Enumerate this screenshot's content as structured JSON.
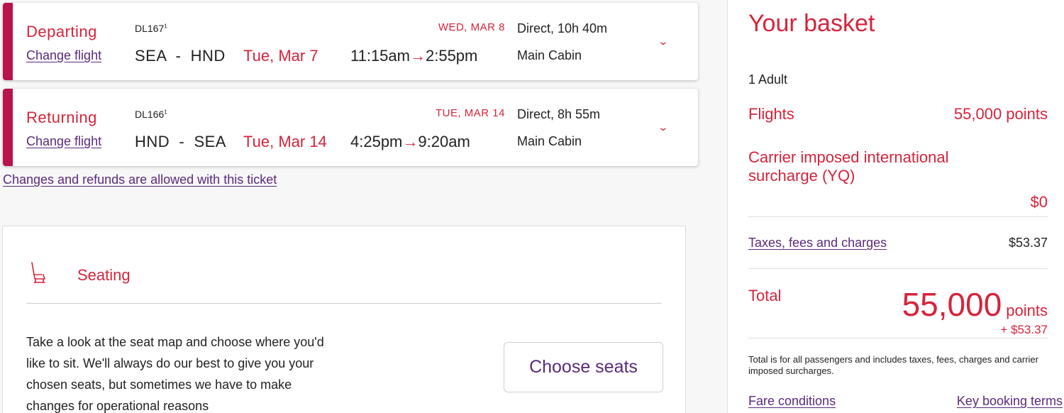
{
  "flights": [
    {
      "direction": "Departing",
      "change_label": "Change flight",
      "flight_number": "DL167",
      "flight_sup": "1",
      "route": "SEA  -  HND",
      "dep_date": "Tue, Mar 7",
      "arr_date": "WED, MAR 8",
      "dep_time": "11:15am",
      "arrow": "→",
      "arr_time": "2:55pm",
      "duration": "Direct, 10h 40m",
      "cabin": "Main Cabin",
      "chevron": "⌄"
    },
    {
      "direction": "Returning",
      "change_label": "Change flight",
      "flight_number": "DL166",
      "flight_sup": "1",
      "route": "HND  -  SEA",
      "dep_date": "Tue, Mar 14",
      "arr_date": "TUE, MAR 14",
      "dep_time": "4:25pm",
      "arrow": "→",
      "arr_time": "9:20am",
      "duration": "Direct, 8h 55m",
      "cabin": "Main Cabin",
      "chevron": "⌄"
    }
  ],
  "refund_link": "Changes and refunds are allowed with this ticket",
  "seating": {
    "title": "Seating",
    "icon": "seat-icon",
    "description": "Take a look at the seat map and choose where you'd like to sit. We'll always do our best to give you your chosen seats, but sometimes we have to make changes for operational reasons",
    "button_label": "Choose seats"
  },
  "basket": {
    "title": "Your basket",
    "passengers": "1 Adult",
    "flights_label": "Flights",
    "flights_value": "55,000 points",
    "surcharge_label": "Carrier imposed international surcharge (YQ)",
    "surcharge_value": "$0",
    "taxes_label": "Taxes, fees and charges",
    "taxes_value": "$53.37",
    "total_label": "Total",
    "total_points": "55,000",
    "total_unit": "points",
    "total_cash": "+ $53.37",
    "note": "Total is for all passengers and includes taxes, fees, charges and carrier imposed surcharges.",
    "fare_conditions": "Fare conditions",
    "key_terms": "Key booking terms"
  },
  "colors": {
    "brand_red": "#d6243b",
    "stripe": "#b8134a",
    "link_purple": "#5a2a7a"
  }
}
